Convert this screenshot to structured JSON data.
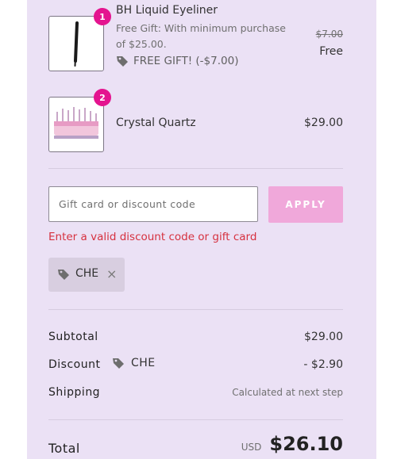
{
  "items": [
    {
      "quantity": "1",
      "name": "BH Liquid Eyeliner",
      "description": "Free Gift: With minimum purchase of $25.00.",
      "description_line1": "Free Gift: With minimum purchase",
      "description_line2": "of $25.00.",
      "discount_label": "FREE GIFT! (-$7.00)",
      "original_price": "$7.00",
      "price": "Free"
    },
    {
      "quantity": "2",
      "name": "Crystal Quartz",
      "price": "$29.00"
    }
  ],
  "discount_form": {
    "placeholder": "Gift card or discount code",
    "apply_label": "APPLY",
    "error": "Enter a valid discount code or gift card",
    "applied_code": "CHE",
    "remove_glyph": "×"
  },
  "summary": {
    "subtotal_label": "Subtotal",
    "subtotal_value": "$29.00",
    "discount_label": "Discount",
    "discount_code": "CHE",
    "discount_value": "- $2.90",
    "shipping_label": "Shipping",
    "shipping_value": "Calculated at next step",
    "total_label": "Total",
    "currency": "USD",
    "total_value": "$26.10"
  },
  "colors": {
    "panel_bg": "#ebe1f5",
    "accent_pink": "#e4148f",
    "apply_button": "#f0a8da",
    "error_red": "#d6313f"
  }
}
